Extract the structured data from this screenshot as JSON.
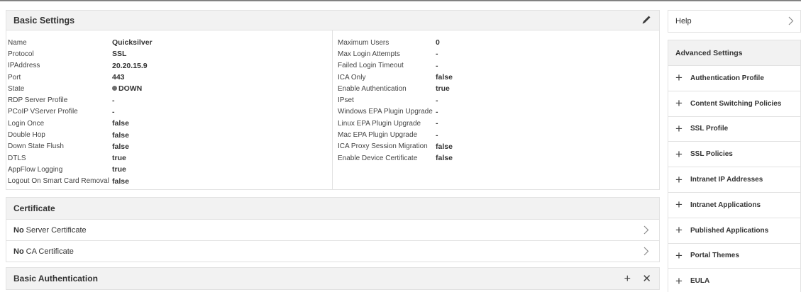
{
  "basic_settings": {
    "title": "Basic Settings",
    "left": [
      {
        "label": "Name",
        "value": "Quicksilver"
      },
      {
        "label": "Protocol",
        "value": "SSL"
      },
      {
        "label": "IPAddress",
        "value": "20.20.15.9"
      },
      {
        "label": "Port",
        "value": "443"
      },
      {
        "label": "State",
        "value": "DOWN",
        "status_dot_color": "#6d6d6d"
      },
      {
        "label": "RDP Server Profile",
        "value": "-"
      },
      {
        "label": "PCoIP VServer Profile",
        "value": "-"
      },
      {
        "label": "Login Once",
        "value": "false"
      },
      {
        "label": "Double Hop",
        "value": "false"
      },
      {
        "label": "Down State Flush",
        "value": "false"
      },
      {
        "label": "DTLS",
        "value": "true"
      },
      {
        "label": "AppFlow Logging",
        "value": "true"
      },
      {
        "label": "Logout On Smart Card Removal",
        "value": "false"
      }
    ],
    "right": [
      {
        "label": "Maximum Users",
        "value": "0"
      },
      {
        "label": "Max Login Attempts",
        "value": "-"
      },
      {
        "label": "Failed Login Timeout",
        "value": "-"
      },
      {
        "label": "ICA Only",
        "value": "false"
      },
      {
        "label": "Enable Authentication",
        "value": "true"
      },
      {
        "label": "IPset",
        "value": "-"
      },
      {
        "label": "Windows EPA Plugin Upgrade",
        "value": "-"
      },
      {
        "label": "Linux EPA Plugin Upgrade",
        "value": "-"
      },
      {
        "label": "Mac EPA Plugin Upgrade",
        "value": "-"
      },
      {
        "label": "ICA Proxy Session Migration",
        "value": "false"
      },
      {
        "label": "Enable Device Certificate",
        "value": "false"
      }
    ]
  },
  "certificate": {
    "title": "Certificate",
    "items": [
      {
        "prefix": "No",
        "label": "Server Certificate"
      },
      {
        "prefix": "No",
        "label": "CA Certificate"
      }
    ]
  },
  "basic_authentication": {
    "title": "Basic Authentication",
    "add_glyph": "+",
    "close_glyph": "✕"
  },
  "sidebar": {
    "help_label": "Help",
    "advanced_title": "Advanced Settings",
    "items": [
      {
        "label": "Authentication Profile"
      },
      {
        "label": "Content Switching Policies"
      },
      {
        "label": "SSL Profile"
      },
      {
        "label": "SSL Policies"
      },
      {
        "label": "Intranet IP Addresses"
      },
      {
        "label": "Intranet Applications"
      },
      {
        "label": "Published Applications"
      },
      {
        "label": "Portal Themes"
      },
      {
        "label": "EULA"
      }
    ]
  },
  "icons": {
    "edit": "pencil-icon",
    "chevron": "chevron-right-icon",
    "add": "plus-icon",
    "close": "close-icon"
  }
}
